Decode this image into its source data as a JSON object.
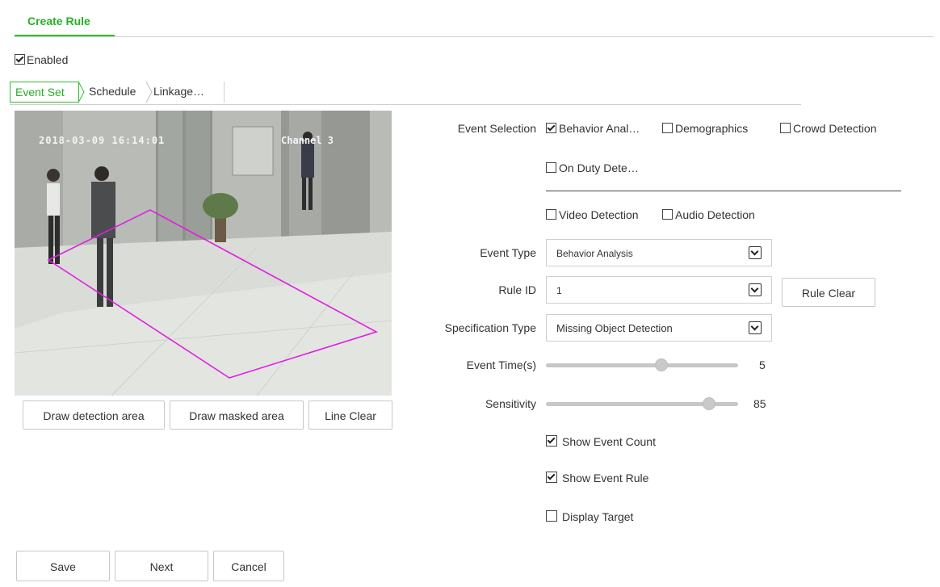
{
  "header": {
    "tab_label": "Create Rule"
  },
  "enabled": {
    "label": "Enabled",
    "checked": true
  },
  "subtabs": [
    {
      "label": "Event Set",
      "active": true
    },
    {
      "label": "Schedule",
      "active": false
    },
    {
      "label": "Linkage…",
      "active": false
    }
  ],
  "video": {
    "timestamp": "2018-03-09 16:14:01",
    "channel": "Channel 3"
  },
  "video_buttons": {
    "draw_detection": "Draw detection area",
    "draw_masked": "Draw masked area",
    "line_clear": "Line Clear"
  },
  "form": {
    "event_selection": {
      "label": "Event Selection",
      "options": [
        {
          "label": "Behavior Anal…",
          "checked": true
        },
        {
          "label": "Demographics",
          "checked": false
        },
        {
          "label": "Crowd Detection",
          "checked": false
        },
        {
          "label": "On Duty Dete…",
          "checked": false
        }
      ]
    },
    "detection_options": [
      {
        "label": "Video Detection",
        "checked": false
      },
      {
        "label": "Audio Detection",
        "checked": false
      }
    ],
    "event_type": {
      "label": "Event Type",
      "value": "Behavior Analysis"
    },
    "rule_id": {
      "label": "Rule ID",
      "value": "1",
      "clear_button": "Rule Clear"
    },
    "specification_type": {
      "label": "Specification Type",
      "value": "Missing Object Detection"
    },
    "event_time": {
      "label": "Event Time(s)",
      "value": "5",
      "level": 0.6
    },
    "sensitivity": {
      "label": "Sensitivity",
      "value": "85",
      "level": 0.85
    },
    "toggles": [
      {
        "label": "Show Event Count",
        "checked": true
      },
      {
        "label": "Show Event Rule",
        "checked": true
      },
      {
        "label": "Display Target",
        "checked": false
      }
    ]
  },
  "footer": {
    "save": "Save",
    "next": "Next",
    "cancel": "Cancel"
  },
  "colors": {
    "accent": "#2ebd2e",
    "region_line": "#e020e0"
  }
}
